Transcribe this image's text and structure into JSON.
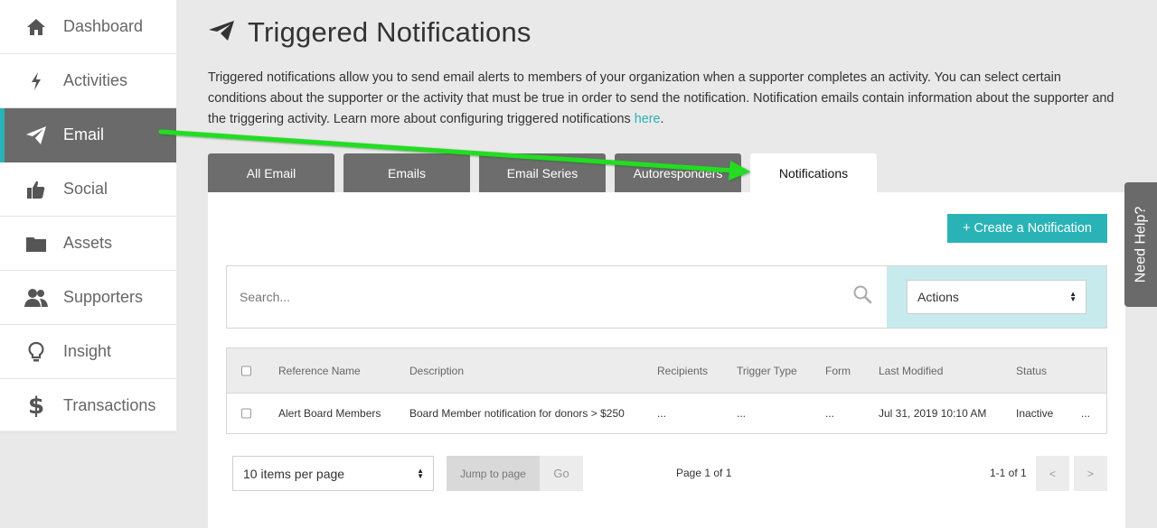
{
  "sidebar": {
    "items": [
      {
        "label": "Dashboard",
        "icon": "home-icon"
      },
      {
        "label": "Activities",
        "icon": "bolt-icon"
      },
      {
        "label": "Email",
        "icon": "paper-plane-icon",
        "active": true
      },
      {
        "label": "Social",
        "icon": "thumbs-up-icon"
      },
      {
        "label": "Assets",
        "icon": "folder-icon"
      },
      {
        "label": "Supporters",
        "icon": "users-icon"
      },
      {
        "label": "Insight",
        "icon": "lightbulb-icon"
      },
      {
        "label": "Transactions",
        "icon": "dollar-icon"
      }
    ]
  },
  "header": {
    "title": "Triggered Notifications",
    "intro_text": "Triggered notifications allow you to send email alerts to members of your organization when a supporter completes an activity. You can select certain conditions about the supporter or the activity that must be true in order to send the notification. Notification emails contain information about the supporter and the triggering activity. Learn more about configuring triggered notifications ",
    "intro_link": "here",
    "intro_end": "."
  },
  "tabs": [
    {
      "label": "All Email"
    },
    {
      "label": "Emails"
    },
    {
      "label": "Email Series"
    },
    {
      "label": "Autoresponders"
    },
    {
      "label": "Notifications",
      "active": true
    }
  ],
  "toolbar": {
    "create_label": "+ Create a Notification",
    "search_placeholder": "Search...",
    "actions_label": "Actions"
  },
  "table": {
    "columns": [
      "Reference Name",
      "Description",
      "Recipients",
      "Trigger Type",
      "Form",
      "Last Modified",
      "Status"
    ],
    "rows": [
      {
        "reference_name": "Alert Board Members",
        "description": "Board Member notification for donors > $250",
        "recipients": "...",
        "trigger_type": "...",
        "form": "...",
        "last_modified": "Jul 31, 2019 10:10 AM",
        "status": "Inactive",
        "more": "..."
      }
    ]
  },
  "footer": {
    "per_page": "10 items per page",
    "jump_placeholder": "Jump to page",
    "go_label": "Go",
    "page_info": "Page 1 of 1",
    "range_info": "1-1 of 1",
    "prev_label": "<",
    "next_label": ">"
  },
  "help": {
    "label": "Need Help?"
  },
  "colors": {
    "accent": "#2ab3b6",
    "sidebar_active": "#6a6a6a",
    "annotation_arrow": "#22dd22"
  }
}
